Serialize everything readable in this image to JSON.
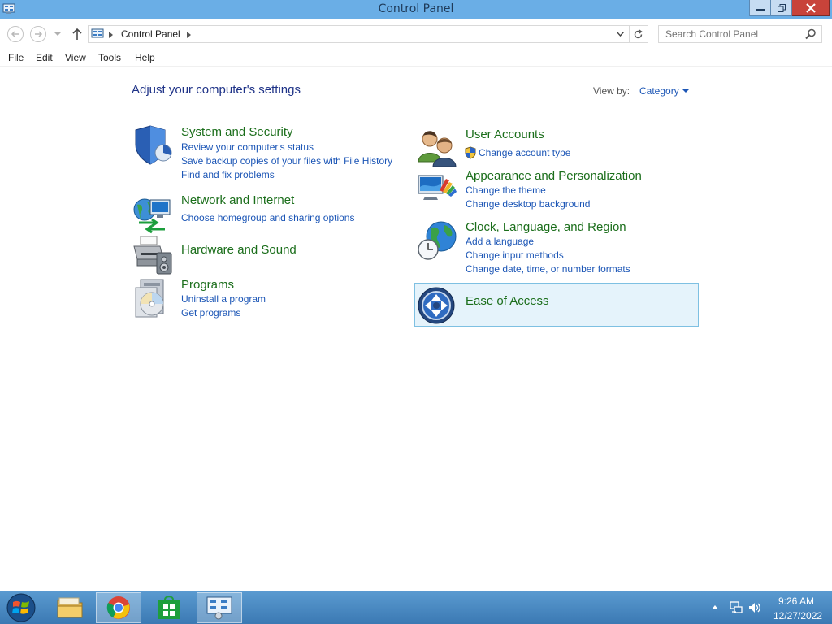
{
  "window": {
    "title": "Control Panel"
  },
  "address": {
    "crumb": "Control Panel",
    "search_placeholder": "Search Control Panel"
  },
  "menu": [
    "File",
    "Edit",
    "View",
    "Tools",
    "Help"
  ],
  "content": {
    "heading": "Adjust your computer's settings",
    "view_by_label": "View by:",
    "view_by_value": "Category"
  },
  "categories_left": [
    {
      "title": "System and Security",
      "icon": "shield-icon",
      "links": [
        "Review your computer's status",
        "Save backup copies of your files with File History",
        "Find and fix problems"
      ]
    },
    {
      "title": "Network and Internet",
      "icon": "network-globe-icon",
      "links": [
        "Choose homegroup and sharing options"
      ]
    },
    {
      "title": "Hardware and Sound",
      "icon": "printer-speaker-icon",
      "links": []
    },
    {
      "title": "Programs",
      "icon": "programs-disc-icon",
      "links": [
        "Uninstall a program",
        "Get programs"
      ]
    }
  ],
  "categories_right": [
    {
      "title": "User Accounts",
      "icon": "users-icon",
      "links": [
        "Change account type"
      ]
    },
    {
      "title": "Appearance and Personalization",
      "icon": "monitor-palette-icon",
      "links": [
        "Change the theme",
        "Change desktop background"
      ]
    },
    {
      "title": "Clock, Language, and Region",
      "icon": "clock-globe-icon",
      "links": [
        "Add a language",
        "Change input methods",
        "Change date, time, or number formats"
      ]
    },
    {
      "title": "Ease of Access",
      "icon": "ease-of-access-icon",
      "links": []
    }
  ],
  "taskbar": {
    "time": "9:26 AM",
    "date": "12/27/2022"
  }
}
